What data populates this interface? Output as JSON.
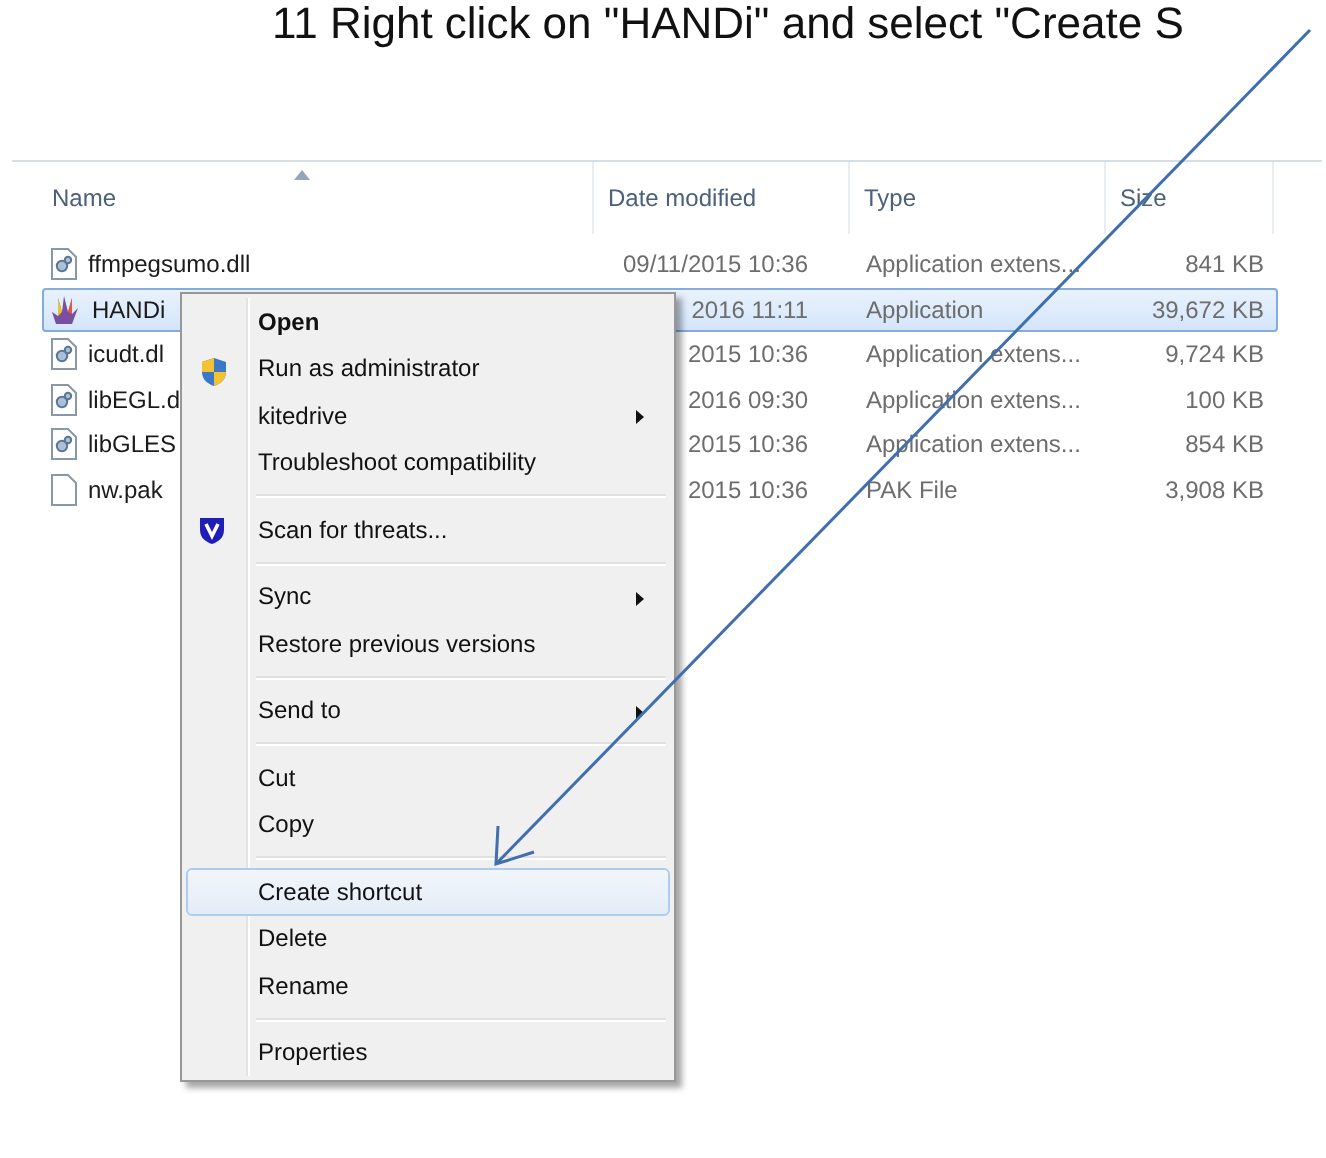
{
  "instruction": "11  Right click on \"HANDi\" and select \"Create S",
  "columns": [
    {
      "label": "Name",
      "sorted": true
    },
    {
      "label": "Date modified",
      "sorted": false
    },
    {
      "label": "Type",
      "sorted": false
    },
    {
      "label": "Size",
      "sorted": false
    }
  ],
  "rows": [
    {
      "kind": "dll",
      "name": "ffmpegsumo.dll",
      "date": "09/11/2015 10:36",
      "type": "Application extens...",
      "size": "841 KB",
      "selected": false
    },
    {
      "kind": "app",
      "name": "HANDi",
      "date": "2016 11:11",
      "type": "Application",
      "size": "39,672 KB",
      "selected": true
    },
    {
      "kind": "dll",
      "name": "icudt.dl",
      "date": "2015 10:36",
      "type": "Application extens...",
      "size": "9,724 KB",
      "selected": false
    },
    {
      "kind": "dll",
      "name": "libEGL.d",
      "date": "2016 09:30",
      "type": "Application extens...",
      "size": "100 KB",
      "selected": false
    },
    {
      "kind": "dll",
      "name": "libGLES",
      "date": "2015 10:36",
      "type": "Application extens...",
      "size": "854 KB",
      "selected": false
    },
    {
      "kind": "file",
      "name": "nw.pak",
      "date": "2015 10:36",
      "type": "PAK File",
      "size": "3,908 KB",
      "selected": false
    }
  ],
  "context_menu": [
    {
      "kind": "item",
      "label": "Open",
      "bold": true,
      "submenu": false,
      "selected": false
    },
    {
      "kind": "shield-item",
      "label": "Run as administrator",
      "bold": false,
      "submenu": false,
      "selected": false
    },
    {
      "kind": "item",
      "label": "kitedrive",
      "bold": false,
      "submenu": true,
      "selected": false
    },
    {
      "kind": "item",
      "label": "Troubleshoot compatibility",
      "bold": false,
      "submenu": false,
      "selected": false
    },
    {
      "kind": "separator"
    },
    {
      "kind": "scan-item",
      "label": "Scan for threats...",
      "bold": false,
      "submenu": false,
      "selected": false
    },
    {
      "kind": "separator"
    },
    {
      "kind": "item",
      "label": "Sync",
      "bold": false,
      "submenu": true,
      "selected": false
    },
    {
      "kind": "item",
      "label": "Restore previous versions",
      "bold": false,
      "submenu": false,
      "selected": false
    },
    {
      "kind": "separator"
    },
    {
      "kind": "item",
      "label": "Send to",
      "bold": false,
      "submenu": true,
      "selected": false
    },
    {
      "kind": "separator"
    },
    {
      "kind": "item",
      "label": "Cut",
      "bold": false,
      "submenu": false,
      "selected": false
    },
    {
      "kind": "item",
      "label": "Copy",
      "bold": false,
      "submenu": false,
      "selected": false
    },
    {
      "kind": "separator"
    },
    {
      "kind": "item",
      "label": "Create shortcut",
      "bold": false,
      "submenu": false,
      "selected": true
    },
    {
      "kind": "item",
      "label": "Delete",
      "bold": false,
      "submenu": false,
      "selected": false
    },
    {
      "kind": "item",
      "label": "Rename",
      "bold": false,
      "submenu": false,
      "selected": false
    },
    {
      "kind": "separator"
    },
    {
      "kind": "item",
      "label": "Properties",
      "bold": false,
      "submenu": false,
      "selected": false
    }
  ]
}
